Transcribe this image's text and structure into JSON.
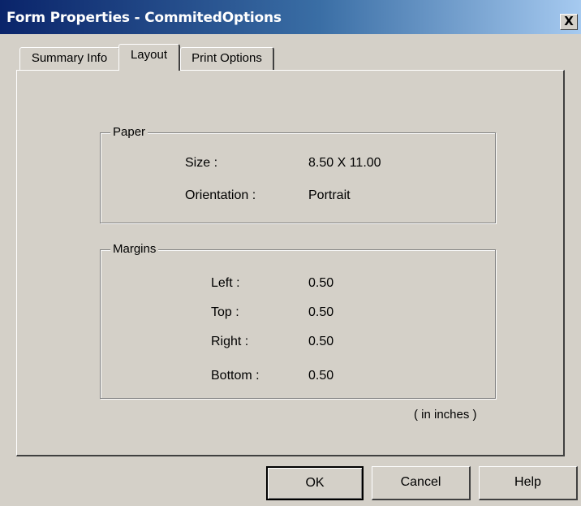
{
  "window": {
    "title": "Form Properties - CommitedOptions",
    "close_label": "X"
  },
  "tabs": [
    {
      "label": "Summary Info"
    },
    {
      "label": "Layout"
    },
    {
      "label": "Print Options"
    }
  ],
  "active_tab": "Layout",
  "paper": {
    "legend": "Paper",
    "size_label": "Size :",
    "size_value": "8.50 X 11.00",
    "orientation_label": "Orientation :",
    "orientation_value": "Portrait"
  },
  "margins": {
    "legend": "Margins",
    "left_label": "Left :",
    "left_value": "0.50",
    "top_label": "Top :",
    "top_value": "0.50",
    "right_label": "Right :",
    "right_value": "0.50",
    "bottom_label": "Bottom :",
    "bottom_value": "0.50"
  },
  "units_note": "( in inches )",
  "buttons": {
    "ok": "OK",
    "cancel": "Cancel",
    "help": "Help"
  }
}
